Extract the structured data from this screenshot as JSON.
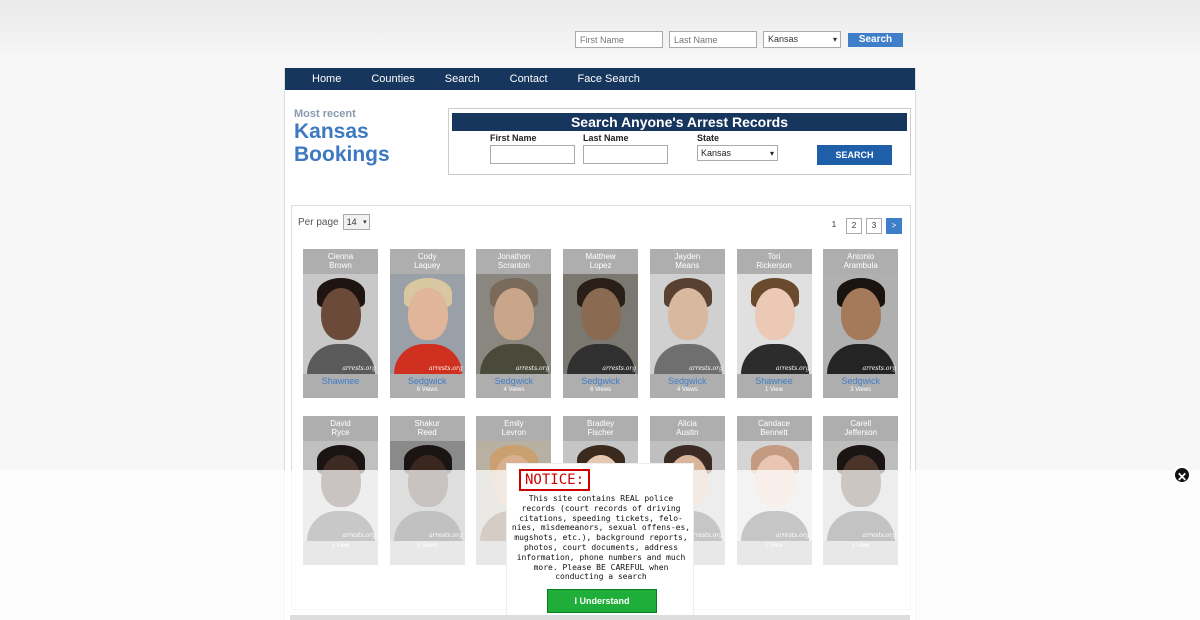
{
  "top_search": {
    "first_placeholder": "First Name",
    "last_placeholder": "Last Name",
    "state": "Kansas",
    "button": "Search"
  },
  "nav": [
    "Home",
    "Counties",
    "Search",
    "Contact",
    "Face Search"
  ],
  "recent": {
    "small": "Most recent",
    "line1": "Kansas",
    "line2": "Bookings"
  },
  "search_box": {
    "title": "Search Anyone's Arrest Records",
    "first_label": "First Name",
    "last_label": "Last Name",
    "state_label": "State",
    "state_value": "Kansas",
    "button": "SEARCH"
  },
  "per_page": {
    "label": "Per page",
    "value": "14"
  },
  "pager": [
    "1",
    "2",
    "3",
    ">"
  ],
  "watermark": "arrests.org",
  "cards": [
    {
      "first": "Cienna",
      "last": "Brown",
      "county": "Shawnee",
      "views": ""
    },
    {
      "first": "Cody",
      "last": "Laquey",
      "county": "Sedgwick",
      "views": "6 Views"
    },
    {
      "first": "Jonathon",
      "last": "Scranton",
      "county": "Sedgwick",
      "views": "4 Views"
    },
    {
      "first": "Matthew",
      "last": "Lopez",
      "county": "Sedgwick",
      "views": "6 Views"
    },
    {
      "first": "Jayden",
      "last": "Means",
      "county": "Sedgwick",
      "views": "4 Views"
    },
    {
      "first": "Tori",
      "last": "Rickerson",
      "county": "Shawnee",
      "views": "1 View"
    },
    {
      "first": "Antonio",
      "last": "Arambula",
      "county": "Sedgwick",
      "views": "3 Views"
    },
    {
      "first": "David",
      "last": "Ryce",
      "county": "",
      "views": "1 View"
    },
    {
      "first": "Shakur",
      "last": "Reed",
      "county": "",
      "views": "3 Views"
    },
    {
      "first": "Emily",
      "last": "Levron",
      "county": "",
      "views": ""
    },
    {
      "first": "Bradley",
      "last": "Fischer",
      "county": "",
      "views": ""
    },
    {
      "first": "Alicia",
      "last": "Austin",
      "county": "",
      "views": ""
    },
    {
      "first": "Candace",
      "last": "Bennett",
      "county": "",
      "views": "1 View"
    },
    {
      "first": "Carell",
      "last": "Jefferson",
      "county": "",
      "views": "1 View"
    }
  ],
  "notice": {
    "title": "NOTICE:",
    "message": "This site contains REAL police records (court records of driving citations, speeding tickets, felo-nies, misdemeanors, sexual offens-es, mugshots, etc.), background reports, photos, court documents, address information, phone numbers and much more. Please BE CAREFUL when conducting a search",
    "button": "I Understand"
  },
  "close_icon": "close-x-icon"
}
